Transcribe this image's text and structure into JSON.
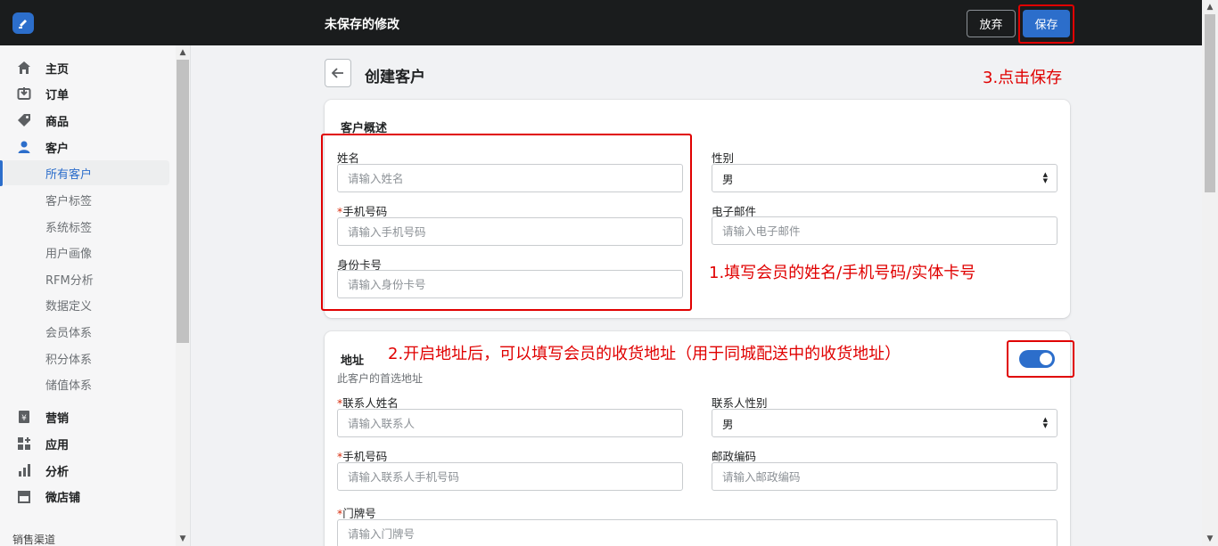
{
  "topbar": {
    "status": "未保存的修改",
    "discard_label": "放弃",
    "save_label": "保存"
  },
  "sidebar": {
    "items": [
      {
        "label": "主页",
        "icon": "home-icon"
      },
      {
        "label": "订单",
        "icon": "orders-icon"
      },
      {
        "label": "商品",
        "icon": "tag-icon"
      },
      {
        "label": "客户",
        "icon": "person-icon"
      }
    ],
    "sub_items": [
      "所有客户",
      "客户标签",
      "系统标签",
      "用户画像",
      "RFM分析",
      "数据定义",
      "会员体系",
      "积分体系",
      "储值体系"
    ],
    "items2": [
      {
        "label": "营销",
        "icon": "marketing-icon"
      },
      {
        "label": "应用",
        "icon": "apps-icon"
      },
      {
        "label": "分析",
        "icon": "analytics-icon"
      },
      {
        "label": "微店铺",
        "icon": "store-icon"
      }
    ],
    "section_caption": "销售渠道"
  },
  "page": {
    "title": "创建客户"
  },
  "annotations": {
    "step1": "1.填写会员的姓名/手机号码/实体卡号",
    "step2": "2.开启地址后，可以填写会员的收货地址（用于同城配送中的收货地址）",
    "step3": "3.点击保存"
  },
  "overview": {
    "title": "客户概述",
    "name_label": "姓名",
    "name_placeholder": "请输入姓名",
    "phone_required": "*",
    "phone_label": "手机号码",
    "phone_placeholder": "请输入手机号码",
    "idcard_label": "身份卡号",
    "idcard_placeholder": "请输入身份卡号",
    "gender_label": "性别",
    "gender_value": "男",
    "email_label": "电子邮件",
    "email_placeholder": "请输入电子邮件"
  },
  "address": {
    "title": "地址",
    "subtitle": "此客户的首选地址",
    "toggle_on": true,
    "contact_name_required": "*",
    "contact_name_label": "联系人姓名",
    "contact_name_placeholder": "请输入联系人",
    "contact_gender_label": "联系人性别",
    "contact_gender_value": "男",
    "phone_required": "*",
    "phone_label": "手机号码",
    "phone_placeholder": "请输入联系人手机号码",
    "postcode_label": "邮政编码",
    "postcode_placeholder": "请输入邮政编码",
    "door_required": "*",
    "door_label": "门牌号",
    "door_placeholder": "请输入门牌号"
  },
  "colors": {
    "accent": "#2c6ecb",
    "annotation": "#e00000",
    "topbar": "#1a1c1d"
  }
}
